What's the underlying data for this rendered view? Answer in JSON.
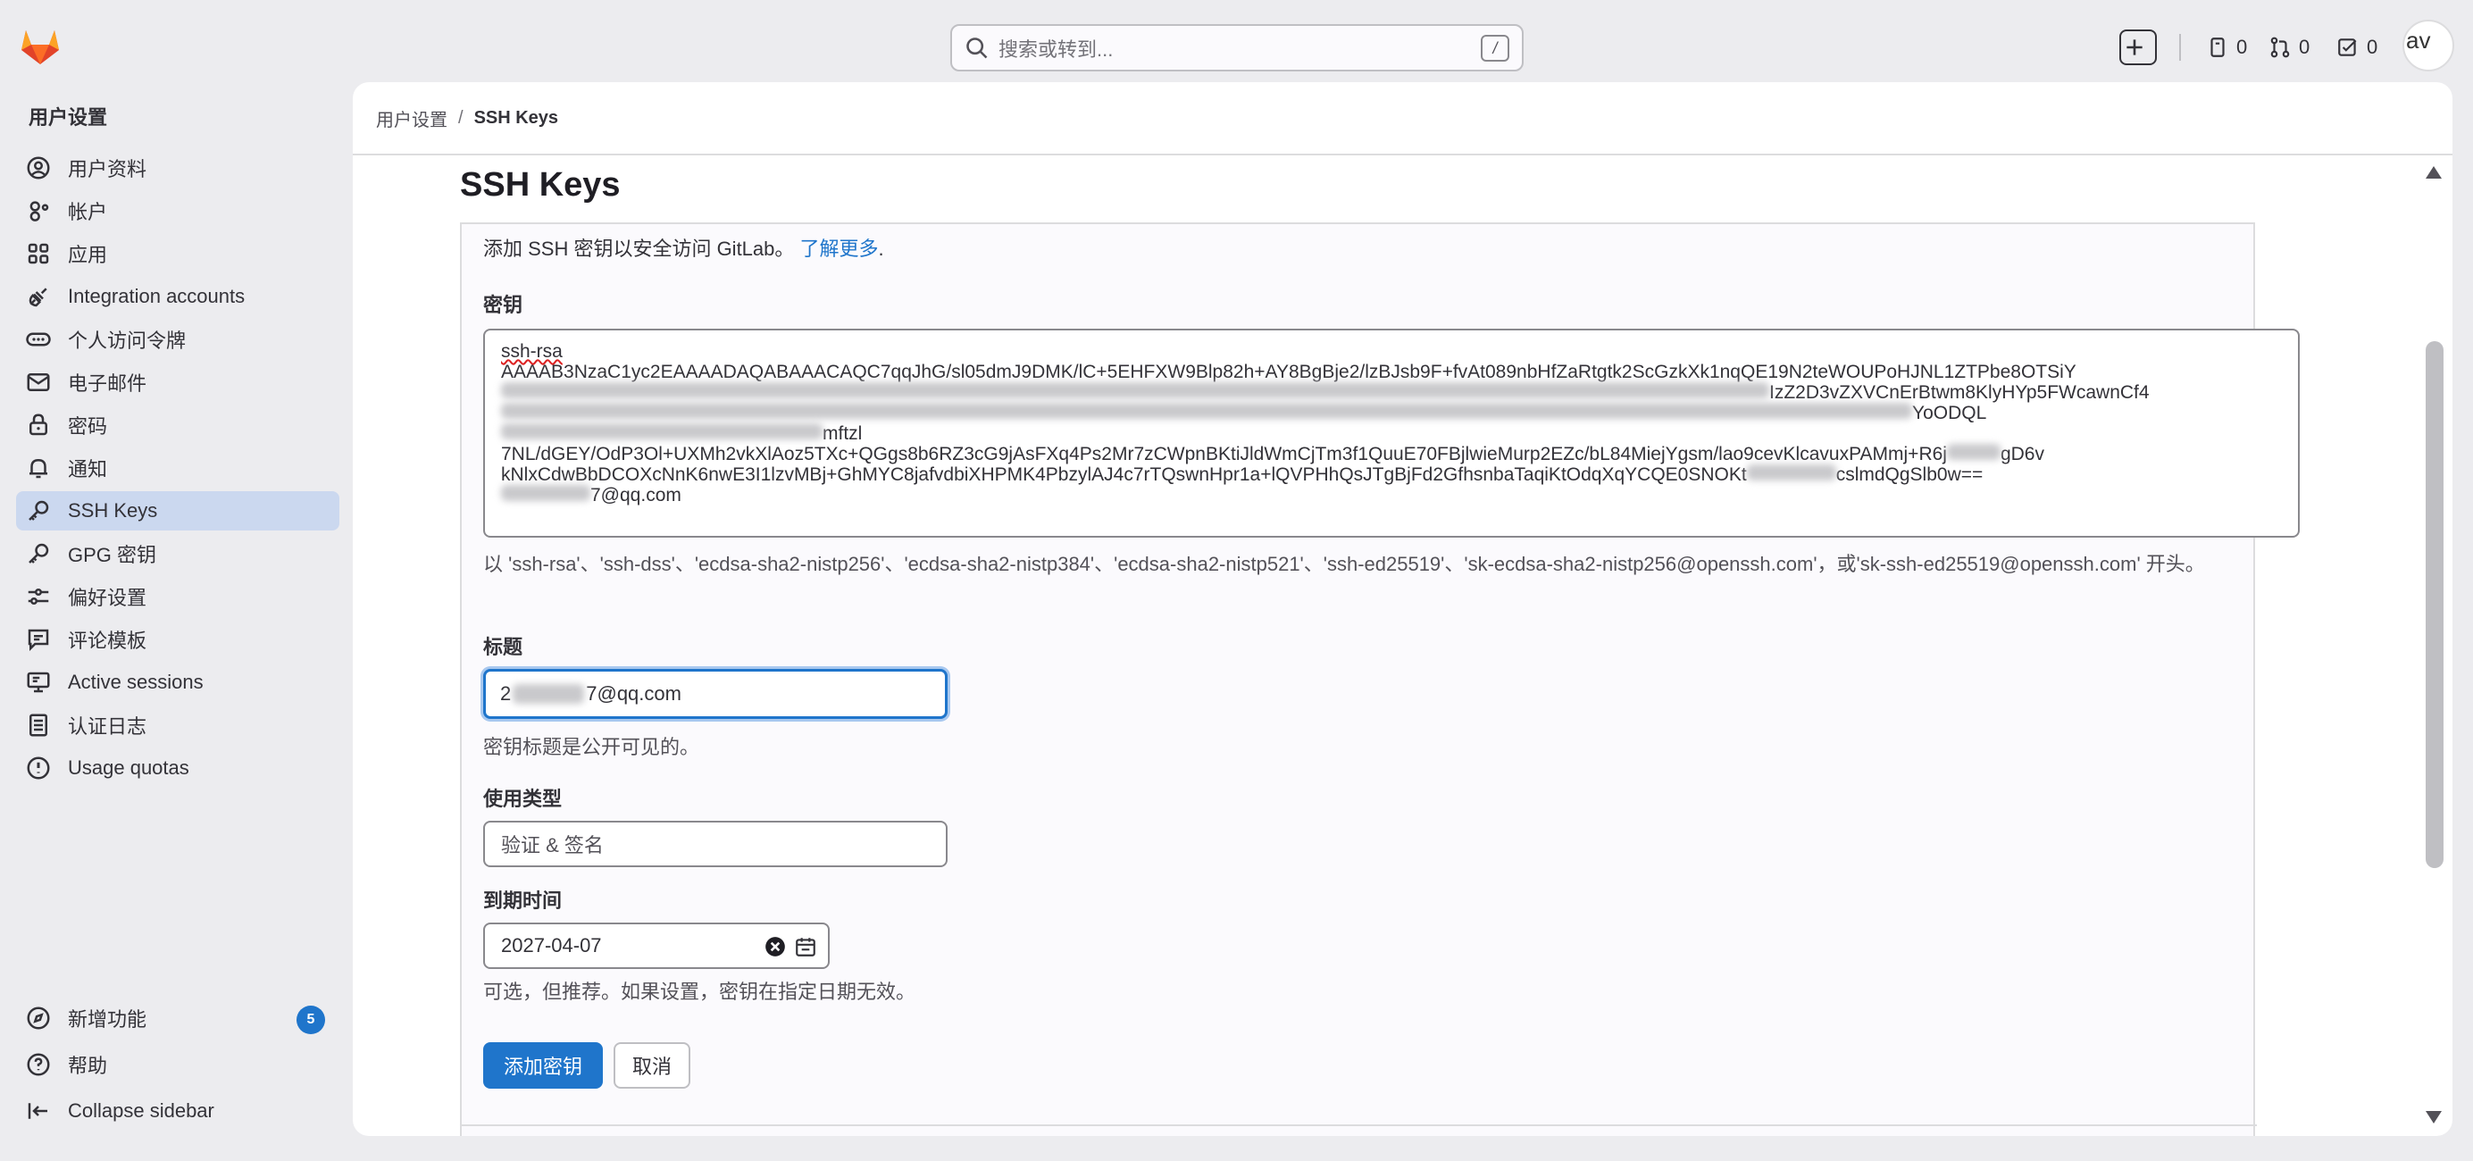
{
  "topbar": {
    "search_placeholder": "搜索或转到...",
    "search_shortcut": "/",
    "issues_count": "0",
    "merge_requests_count": "0",
    "todos_count": "0",
    "avatar_alt": "av"
  },
  "sidebar": {
    "title": "用户设置",
    "items": [
      {
        "label": "用户资料",
        "icon": "user-icon"
      },
      {
        "label": "帐户",
        "icon": "account-icon"
      },
      {
        "label": "应用",
        "icon": "applications-icon"
      },
      {
        "label": "Integration accounts",
        "icon": "integration-icon"
      },
      {
        "label": "个人访问令牌",
        "icon": "token-icon"
      },
      {
        "label": "电子邮件",
        "icon": "mail-icon"
      },
      {
        "label": "密码",
        "icon": "lock-icon"
      },
      {
        "label": "通知",
        "icon": "bell-icon"
      },
      {
        "label": "SSH Keys",
        "icon": "key-icon",
        "active": true
      },
      {
        "label": "GPG 密钥",
        "icon": "key-icon"
      },
      {
        "label": "偏好设置",
        "icon": "preferences-icon"
      },
      {
        "label": "评论模板",
        "icon": "comment-icon"
      },
      {
        "label": "Active sessions",
        "icon": "monitor-icon"
      },
      {
        "label": "认证日志",
        "icon": "log-icon"
      },
      {
        "label": "Usage quotas",
        "icon": "quota-icon"
      }
    ],
    "whats_new": "新增功能",
    "whats_new_badge": "5",
    "help": "帮助",
    "collapse": "Collapse sidebar"
  },
  "breadcrumb": {
    "parent": "用户设置",
    "separator": "/",
    "current": "SSH Keys"
  },
  "page": {
    "title": "SSH Keys",
    "intro": "添加 SSH 密钥以安全访问 GitLab。",
    "intro_link": "了解更多",
    "intro_end": "."
  },
  "form": {
    "key_label": "密钥",
    "key_line1": "ssh-rsa",
    "key_line2": "AAAAB3NzaC1yc2EAAAADAQABAAACAQC7qqJhG/sl05dmJ9DMK/lC+5EHFXW9Blp82h+AY8BgBje2/lzBJsb9F+fvAt089nbHfZaRtgtk2ScGzkXk1nqQE19N2teWOUPoHJNL1ZTPbe8OTSiY",
    "key_line3": "IzZ2D3vZXVCnErBtwm8KlyHYp5FWcawnCf4",
    "key_line4a": "YoODQL",
    "key_line4b": "mftzl",
    "key_line5": "7NL/dGEY/OdP3Ol+UXMh2vkXlAoz5TXc+QGgs8b6RZ3cG9jAsFXq4Ps2Mr7zCWpnBKtiJldWmCjTm3f1QuuE70FBjlwieMurp2EZc/bL84MiejYgsm/lao9cevKlcavuxPAMmj+R6j",
    "key_line5b": "gD6v",
    "key_line6": "kNlxCdwBbDCOXcNnK6nwE3I1lzvMBj+GhMYC8jafvdbiXHPMK4PbzylAJ4c7rTQswnHpr1a+lQVPHhQsJTgBjFd2GfhsnbaTaqiKtOdqXqYCQE0SNOKt",
    "key_line6b": "cslmdQgSlb0w==",
    "key_line7": "7@qq.com",
    "key_hint": "以 'ssh-rsa'、'ssh-dss'、'ecdsa-sha2-nistp256'、'ecdsa-sha2-nistp384'、'ecdsa-sha2-nistp521'、'ssh-ed25519'、'sk-ecdsa-sha2-nistp256@openssh.com'，或'sk-ssh-ed25519@openssh.com' 开头。",
    "title_label": "标题",
    "title_prefix": "2",
    "title_suffix": "7@qq.com",
    "title_hint": "密钥标题是公开可见的。",
    "usage_label": "使用类型",
    "usage_value": "验证 & 签名",
    "expiry_label": "到期时间",
    "expiry_value": "2027-04-07",
    "expiry_hint": "可选，但推荐。如果设置，密钥在指定日期无效。",
    "submit": "添加密钥",
    "cancel": "取消"
  },
  "colors": {
    "accent": "#1f75cb",
    "active_nav": "#cbd8ef",
    "logo_orange": "#e24329"
  }
}
